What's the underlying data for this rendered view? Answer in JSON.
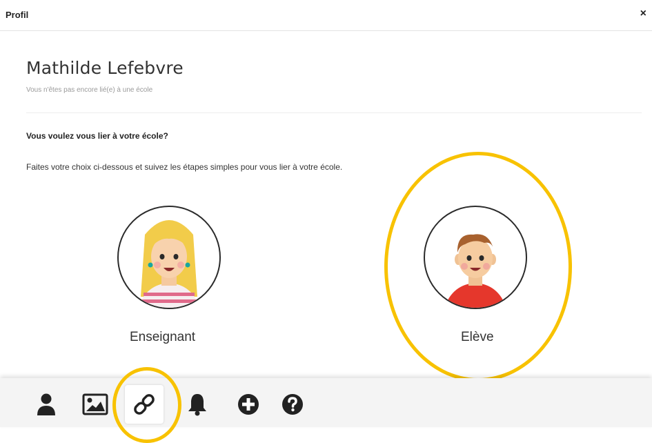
{
  "header": {
    "title": "Profil",
    "close_label": "×"
  },
  "profile": {
    "name": "Mathilde Lefebvre",
    "status": "Vous n'êtes pas encore lié(e) à une école"
  },
  "link_section": {
    "question": "Vous voulez vous lier à votre école?",
    "instructions": "Faites votre choix ci-dessous et suivez les étapes simples pour vous lier à votre école."
  },
  "choices": [
    {
      "label": "Enseignant",
      "icon": "teacher-avatar-icon"
    },
    {
      "label": "Elève",
      "icon": "student-avatar-icon"
    }
  ],
  "bottom_tabs": [
    {
      "icon": "user-icon"
    },
    {
      "icon": "image-icon"
    },
    {
      "icon": "link-icon",
      "active": true
    },
    {
      "icon": "bell-icon"
    },
    {
      "icon": "plus-circle-icon"
    },
    {
      "icon": "question-circle-icon"
    }
  ],
  "colors": {
    "highlight": "#f8c200",
    "icon": "#222222"
  }
}
